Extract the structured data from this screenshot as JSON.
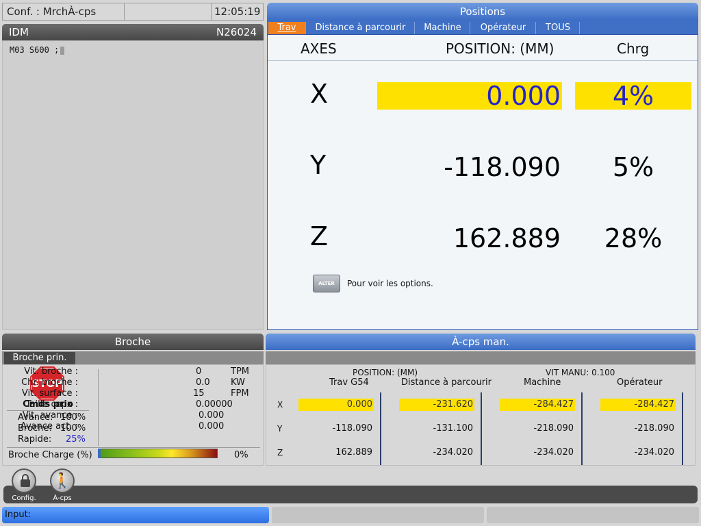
{
  "status": {
    "mode": "Conf. : MrchÀ-cps",
    "time": "12:05:19"
  },
  "program": {
    "title": "IDM",
    "block": "N26024",
    "line": "M03 S600 ;"
  },
  "positions": {
    "title": "Positions",
    "tabs": [
      "Trav",
      "Distance à parcourir",
      "Machine",
      "Opérateur",
      "TOUS"
    ],
    "header_axes": "AXES",
    "header_position": "POSITION:  (MM)",
    "header_load": "Chrg",
    "rows": [
      {
        "axis": "X",
        "value": "0.000",
        "load": "4%"
      },
      {
        "axis": "Y",
        "value": "-118.090",
        "load": "5%"
      },
      {
        "axis": "Z",
        "value": "162.889",
        "load": "28%"
      }
    ],
    "alter_key": "ALTER",
    "hint": "Pour voir les options."
  },
  "spindle": {
    "title": "Broche",
    "tab": "Broche prin.",
    "stop_label": "STOP",
    "cmds": "Cmds prio",
    "overrides": [
      {
        "label": "Avance:",
        "value": "100%"
      },
      {
        "label": "Broche:",
        "value": "100%"
      },
      {
        "label": "Rapide:",
        "value": "25%"
      }
    ],
    "params": [
      {
        "label": "Vit. broche :",
        "value": "0",
        "unit": "TPM"
      },
      {
        "label": "Chr. broche :",
        "value": "0.0",
        "unit": "KW"
      },
      {
        "label": "Vit. surface :",
        "value": "15",
        "unit": "FPM"
      },
      {
        "label": "Taille copx :",
        "value": "0.00000",
        "unit": ""
      },
      {
        "label": "Vit. avance :",
        "value": "0.000",
        "unit": ""
      },
      {
        "label": "Avance act. :",
        "value": "0.000",
        "unit": ""
      }
    ],
    "load_label": "Broche Charge (%)",
    "load_percent": "0%"
  },
  "jog": {
    "title": "À-cps man.",
    "position_caption": "POSITION: (MM)",
    "speed_caption": "VIT MANU: 0.100",
    "columns": [
      "Trav G54",
      "Distance à parcourir",
      "Machine",
      "Opérateur"
    ],
    "rows": [
      {
        "axis": "X",
        "values": [
          "0.000",
          "-231.620",
          "-284.427",
          "-284.427"
        ]
      },
      {
        "axis": "Y",
        "values": [
          "-118.090",
          "-131.100",
          "-218.090",
          "-218.090"
        ]
      },
      {
        "axis": "Z",
        "values": [
          "162.889",
          "-234.020",
          "-234.020",
          "-234.020"
        ]
      }
    ]
  },
  "iconbar": {
    "config": "Config.",
    "jog": "À-cps"
  },
  "input": {
    "label": "Input:"
  },
  "colors": {
    "highlight": "#ffe100",
    "accent_blue": "#3b6cc4",
    "active_tab": "#f07f1e"
  }
}
